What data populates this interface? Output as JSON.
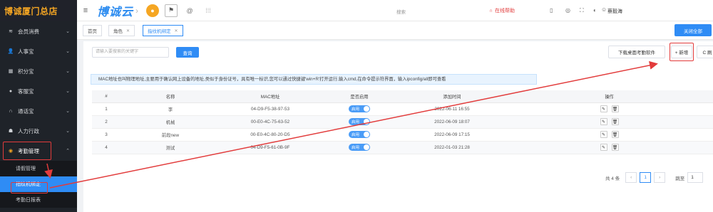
{
  "sidebar": {
    "brand": "博诚厦门总店",
    "items": [
      {
        "label": "会员消费",
        "icon": "db-icon"
      },
      {
        "label": "人事宝",
        "icon": "user-icon"
      },
      {
        "label": "积分宝",
        "icon": "gift-icon"
      },
      {
        "label": "客服宝",
        "icon": "service-icon"
      },
      {
        "label": "通话宝",
        "icon": "headset-icon"
      },
      {
        "label": "人力行政",
        "icon": "group-icon"
      },
      {
        "label": "考勤管理",
        "icon": "clock-icon"
      }
    ],
    "sub_items": [
      "请假管理",
      "指纹机绑定",
      "考勤日报表"
    ]
  },
  "topbar": {
    "logo": "博诚云",
    "search": "搜索",
    "help": "在线帮助",
    "user": "蔡毅海"
  },
  "tabs": [
    "首页",
    "角色",
    "指纹机绑定"
  ],
  "close_all": "关闭全部",
  "search_placeholder": "请输入要搜索的关键字",
  "query_label": "查询",
  "download_label": "下载桌面考勤软件",
  "add_label": "+ 新增",
  "refresh_label": "C 刷",
  "notice": "MAC地址也叫物理地址,主要用于确认网上设备的地址,类似于身份证号，具有唯一标识,您可以通过快捷键'win+R'打开运行,输入cmd,在命令提示符界面，输入ipconfig/all即可查看",
  "table": {
    "headers": [
      "#",
      "名称",
      "MAC地址",
      "是否启用",
      "添加时间",
      "操作"
    ],
    "rows": [
      {
        "no": "1",
        "name": "李",
        "mac": "04-D9-F5-38-97-53",
        "enabled": "启用",
        "time": "2022-06-11 16:55"
      },
      {
        "no": "2",
        "name": "机械",
        "mac": "00-E0-4C-75-63-52",
        "enabled": "启用",
        "time": "2022-06-09 18:07"
      },
      {
        "no": "3",
        "name": "前段new",
        "mac": "00-E0-4C-80-20-D5",
        "enabled": "启用",
        "time": "2022-06-09 17:15"
      },
      {
        "no": "4",
        "name": "测试",
        "mac": "04-D9-F5-61-0B-9F",
        "enabled": "启用",
        "time": "2022-01-03 21:28"
      }
    ]
  },
  "pager": {
    "total": "共 4 条",
    "page": "1",
    "goto": "跳至",
    "goto_value": "1"
  },
  "colors": {
    "accent": "#2f8cf5",
    "annotation": "#e23b3b",
    "brand": "#f5a623"
  }
}
